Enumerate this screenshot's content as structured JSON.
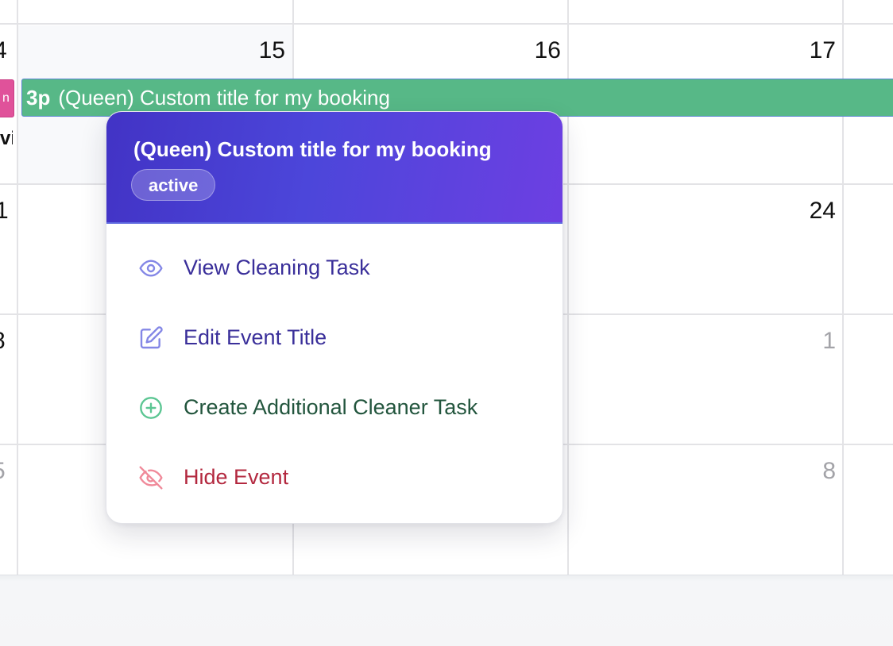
{
  "calendar": {
    "week1": {
      "d14": "4",
      "d15": "15",
      "d16": "16",
      "d17": "17"
    },
    "week2": {
      "d21": "1",
      "d24": "24"
    },
    "week3": {
      "d28": "8",
      "d1": "1"
    },
    "week4": {
      "d5": "5",
      "d8": "8"
    },
    "pink_event_text": "n",
    "cut_event_text": "vi",
    "event": {
      "time": "3p",
      "title": "(Queen) Custom title for my booking"
    }
  },
  "popover": {
    "title": "(Queen) Custom title for my booking",
    "status": "active",
    "items": [
      {
        "label": "View Cleaning Task",
        "icon": "eye-icon",
        "color": "#3a2f9a"
      },
      {
        "label": "Edit Event Title",
        "icon": "edit-icon",
        "color": "#3a2f9a"
      },
      {
        "label": "Create Additional Cleaner Task",
        "icon": "plus-circle-icon",
        "color": "#22553d"
      },
      {
        "label": "Hide Event",
        "icon": "eye-off-icon",
        "color": "#b3283f"
      }
    ]
  },
  "colors": {
    "event_green": "#57b887",
    "event_pink": "#e0529a",
    "header_gradient_start": "#4233c5",
    "header_gradient_end": "#6d3fe2"
  }
}
